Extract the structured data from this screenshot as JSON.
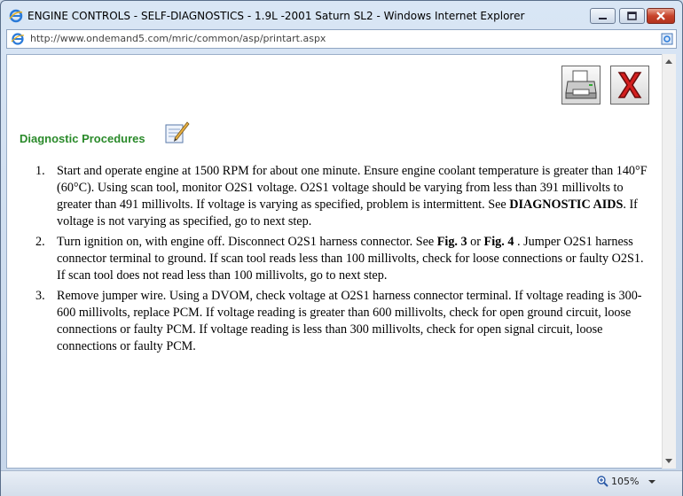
{
  "window": {
    "title": "ENGINE CONTROLS - SELF-DIAGNOSTICS - 1.9L -2001 Saturn SL2 - Windows Internet Explorer",
    "url": "http://www.ondemand5.com/mric/common/asp/printart.aspx"
  },
  "toolbar": {
    "print_icon": "printer-icon",
    "close_icon": "red-x-close-icon"
  },
  "section": {
    "heading": "Diagnostic Procedures",
    "heading_icon": "notepad-edit-icon"
  },
  "steps": [
    {
      "num": "1.",
      "t1": "Start and operate engine at 1500 RPM for about one minute. Ensure engine coolant temperature is greater than 140°F (60°C). Using scan tool, monitor O2S1 voltage. O2S1 voltage should be varying from less than 391 millivolts to greater than 491 millivolts. If voltage is varying as specified, problem is intermittent. See ",
      "b1": "DIAGNOSTIC AIDS",
      "t2": ". If voltage is not varying as specified, go to next step."
    },
    {
      "num": "2.",
      "t1": "Turn ignition on, with engine off. Disconnect O2S1 harness connector. See ",
      "b1": "Fig. 3",
      "t2": " or ",
      "b2": "Fig. 4",
      "t3": " . Jumper O2S1 harness connector terminal to ground. If scan tool reads less than 100 millivolts, check for loose connections or faulty O2S1. If scan tool does not read less than 100 millivolts, go to next step."
    },
    {
      "num": "3.",
      "t1": "Remove jumper wire. Using a DVOM, check voltage at O2S1 harness connector terminal. If voltage reading is 300-600 millivolts, replace PCM. If voltage reading is greater than 600 millivolts, check for open ground circuit, loose connections or faulty PCM. If voltage reading is less than 300 millivolts, check for open signal circuit, loose connections or faulty PCM."
    }
  ],
  "status": {
    "zoom": "105%"
  },
  "colors": {
    "heading": "#2a8a2a",
    "close_x": "#d41e1e"
  }
}
